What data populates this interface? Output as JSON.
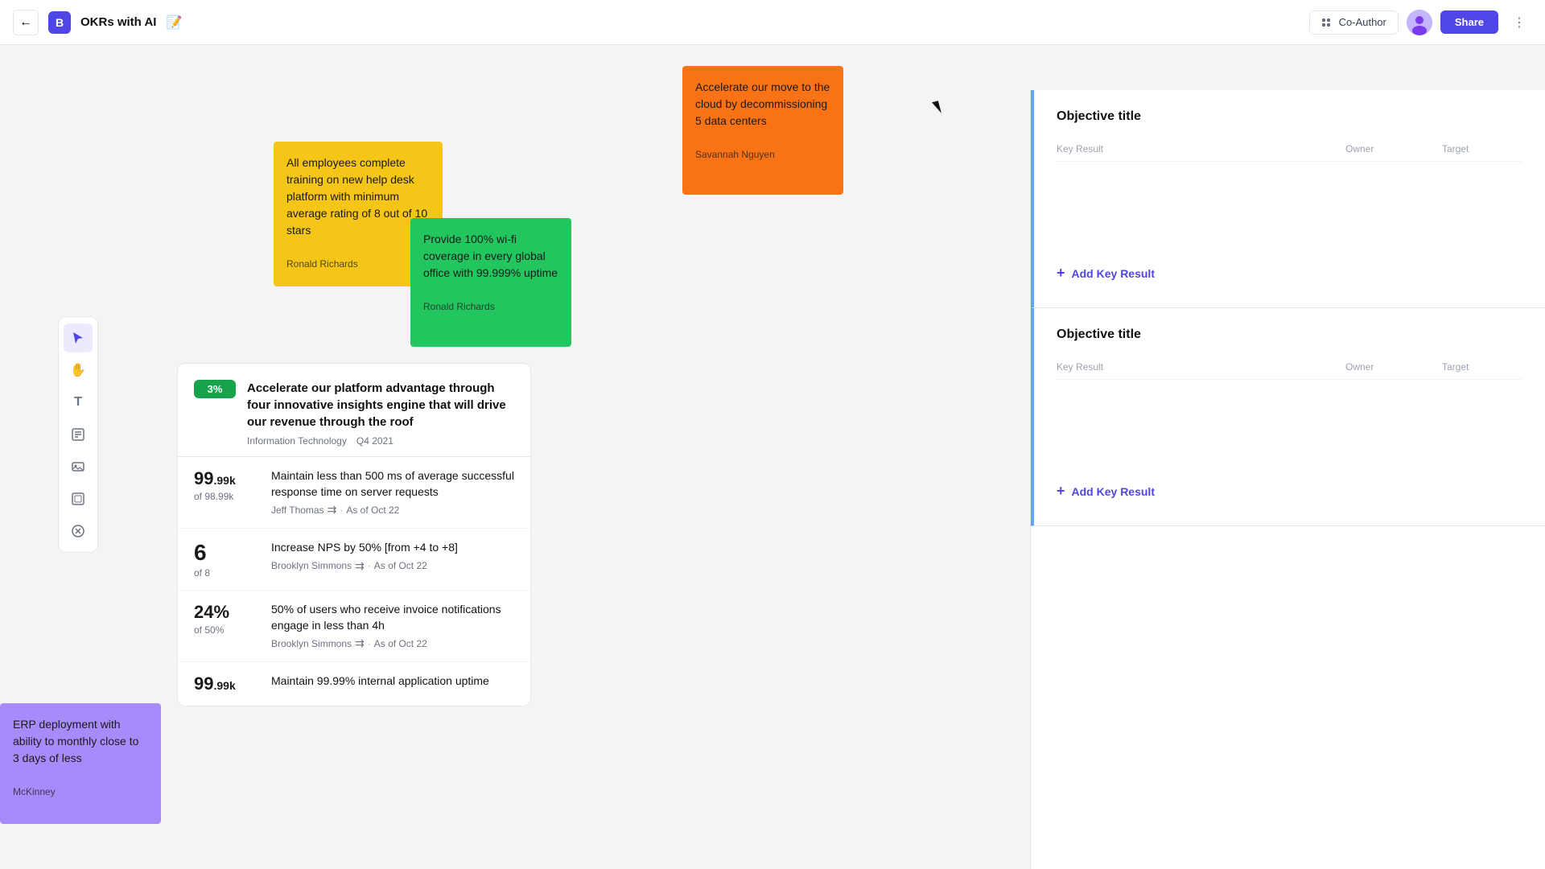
{
  "topbar": {
    "back_label": "←",
    "logo_label": "B",
    "title": "OKRs with AI",
    "emoji": "📝",
    "coauthor_label": "Co-Author",
    "share_label": "Share"
  },
  "tools": [
    {
      "name": "select",
      "icon": "↖",
      "active": true
    },
    {
      "name": "hand",
      "icon": "✋",
      "active": false
    },
    {
      "name": "text",
      "icon": "T",
      "active": false
    },
    {
      "name": "sticky",
      "icon": "⬜",
      "active": false
    },
    {
      "name": "image",
      "icon": "🖼",
      "active": false
    },
    {
      "name": "frame",
      "icon": "⬛",
      "active": false
    },
    {
      "name": "plugin",
      "icon": "✳",
      "active": false
    }
  ],
  "stickies": {
    "yellow": {
      "text": "All employees complete training on new help desk platform with minimum average rating of 8 out of 10 stars",
      "author": "Ronald Richards"
    },
    "green": {
      "text": "Provide 100% wi-fi coverage in every global office with 99.999% uptime",
      "author": "Ronald Richards"
    },
    "orange": {
      "text": "Accelerate our move to the cloud by decommissioning 5 data centers",
      "author": "Savannah Nguyen"
    },
    "purple": {
      "text": "ERP deployment with ability to monthly close to 3 days of less",
      "author": "McKinney"
    }
  },
  "okr_card": {
    "percent": "3%",
    "title": "Accelerate our platform advantage through four innovative insights engine that will drive our revenue through the roof",
    "department": "Information Technology",
    "quarter": "Q4 2021",
    "key_results": [
      {
        "main": "99",
        "main_sub": ".99k",
        "of": "of 98.99k",
        "description": "Maintain less than 500 ms of average successful response time on server requests",
        "owner": "Jeff  Thomas",
        "date": "As of Oct 22"
      },
      {
        "main": "6",
        "main_sub": "",
        "of": "of 8",
        "description": "Increase NPS by 50% [from +4 to +8]",
        "owner": "Brooklyn Simmons",
        "date": "As of Oct 22"
      },
      {
        "main": "24%",
        "main_sub": "",
        "of": "of 50%",
        "description": "50% of users who receive invoice notifications engage in less than 4h",
        "owner": "Brooklyn Simmons",
        "date": "As of Oct 22"
      },
      {
        "main": "99",
        "main_sub": ".99k",
        "of": "",
        "description": "Maintain 99.99% internal application uptime",
        "owner": "",
        "date": ""
      }
    ]
  },
  "right_panel": {
    "objective1": {
      "title": "Objective title",
      "columns": [
        "Key Result",
        "Owner",
        "Target"
      ],
      "add_kr_label": "Add Key Result"
    },
    "objective2": {
      "title": "Objective title",
      "columns": [
        "Key Result",
        "Owner",
        "Target"
      ],
      "add_kr_label": "Add Key Result"
    }
  }
}
